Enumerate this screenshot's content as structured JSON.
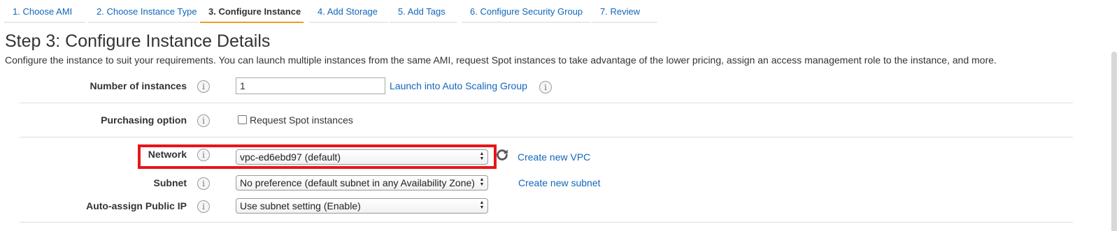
{
  "tabs": [
    {
      "label": "1. Choose AMI",
      "active": false
    },
    {
      "label": "2. Choose Instance Type",
      "active": false
    },
    {
      "label": "3. Configure Instance",
      "active": true
    },
    {
      "label": "4. Add Storage",
      "active": false
    },
    {
      "label": "5. Add Tags",
      "active": false
    },
    {
      "label": "6. Configure Security Group",
      "active": false
    },
    {
      "label": "7. Review",
      "active": false
    }
  ],
  "page": {
    "title": "Step 3: Configure Instance Details",
    "description": "Configure the instance to suit your requirements. You can launch multiple instances from the same AMI, request Spot instances to take advantage of the lower pricing, assign an access management role to the instance, and more."
  },
  "form": {
    "number_of_instances": {
      "label": "Number of instances",
      "value": "1",
      "link": "Launch into Auto Scaling Group"
    },
    "purchasing_option": {
      "label": "Purchasing option",
      "checkbox_label": "Request Spot instances",
      "checked": false
    },
    "network": {
      "label": "Network",
      "selected": "vpc-ed6ebd97 (default)",
      "link": "Create new VPC",
      "highlighted": true
    },
    "subnet": {
      "label": "Subnet",
      "selected": "No preference (default subnet in any Availability Zone)",
      "link": "Create new subnet"
    },
    "auto_assign_public_ip": {
      "label": "Auto-assign Public IP",
      "selected": "Use subnet setting (Enable)"
    }
  },
  "colors": {
    "link": "#1166bb",
    "active_tab_underline": "#ec9c1e",
    "highlight_border": "#e8151b"
  },
  "icons": {
    "info": "i"
  }
}
